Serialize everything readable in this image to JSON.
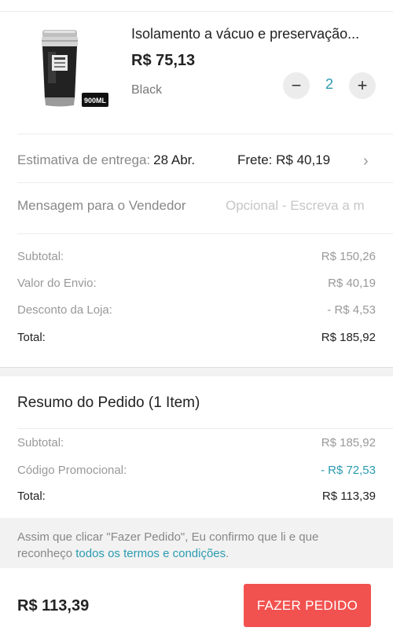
{
  "product": {
    "title": "Isolamento a vácuo e preservação...",
    "price": "R$ 75,13",
    "variant": "Black",
    "quantity": "2",
    "minus_symbol": "−",
    "plus_symbol": "+",
    "thumb_label": "900ML"
  },
  "delivery": {
    "label": "Estimativa de entrega:",
    "date": "28 Abr.",
    "freight": "Frete: R$ 40,19",
    "chevron": "›"
  },
  "message": {
    "label": "Mensagem para o Vendedor",
    "placeholder": "Opcional - Escreva a m"
  },
  "store_summary": [
    {
      "label": "Subtotal:",
      "value": "R$ 150,26"
    },
    {
      "label": "Valor do Envio:",
      "value": "R$ 40,19"
    },
    {
      "label": "Desconto da Loja:",
      "value": "- R$ 4,53"
    },
    {
      "label": "Total:",
      "value": "R$ 185,92"
    }
  ],
  "order_summary": {
    "title": "Resumo do Pedido (1 Item)",
    "rows": [
      {
        "label": "Subtotal:",
        "value": "R$ 185,92"
      },
      {
        "label": "Código Promocional:",
        "value": "- R$ 72,53"
      },
      {
        "label": "Total:",
        "value": "R$ 113,39"
      }
    ]
  },
  "notice": {
    "text": "Assim que clicar \"Fazer Pedido\", Eu confirmo que li e que reconheço ",
    "link": "todos os termos e condições",
    "suffix": "."
  },
  "footer": {
    "total": "R$ 113,39",
    "button": "FAZER PEDIDO"
  },
  "colors": {
    "accent": "#2a9bb0",
    "button": "#f2524f"
  }
}
